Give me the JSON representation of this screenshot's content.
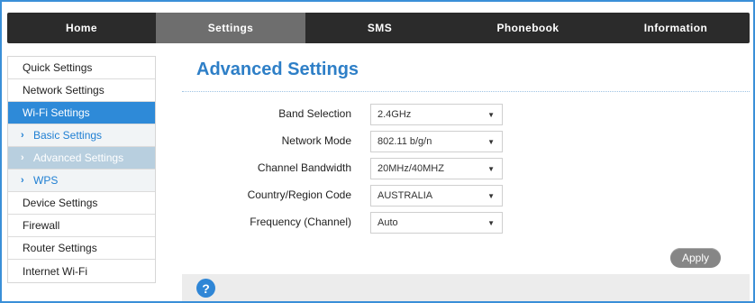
{
  "topnav": {
    "tabs": [
      {
        "label": "Home",
        "active": false
      },
      {
        "label": "Settings",
        "active": true
      },
      {
        "label": "SMS",
        "active": false
      },
      {
        "label": "Phonebook",
        "active": false
      },
      {
        "label": "Information",
        "active": false
      }
    ]
  },
  "sidebar": {
    "items": [
      {
        "label": "Quick Settings",
        "type": "item"
      },
      {
        "label": "Network Settings",
        "type": "item"
      },
      {
        "label": "Wi-Fi Settings",
        "type": "item",
        "active": true
      },
      {
        "label": "Basic Settings",
        "type": "sub"
      },
      {
        "label": "Advanced Settings",
        "type": "sub",
        "selected": true
      },
      {
        "label": "WPS",
        "type": "sub"
      },
      {
        "label": "Device Settings",
        "type": "item"
      },
      {
        "label": "Firewall",
        "type": "item"
      },
      {
        "label": "Router Settings",
        "type": "item"
      },
      {
        "label": "Internet Wi-Fi",
        "type": "item"
      }
    ],
    "chevron": "›"
  },
  "main": {
    "title": "Advanced Settings",
    "fields": [
      {
        "label": "Band Selection",
        "value": "2.4GHz"
      },
      {
        "label": "Network Mode",
        "value": "802.11 b/g/n"
      },
      {
        "label": "Channel Bandwidth",
        "value": "20MHz/40MHZ"
      },
      {
        "label": "Country/Region Code",
        "value": "AUSTRALIA"
      },
      {
        "label": "Frequency (Channel)",
        "value": "Auto"
      }
    ],
    "apply_label": "Apply"
  },
  "footer": {
    "help_glyph": "?"
  },
  "colors": {
    "accent": "#2e8ad8",
    "title": "#2e7fc7",
    "nav_bg": "#2b2b2b",
    "nav_active": "#6e6e6e",
    "apply_bg": "#868686"
  },
  "icons": {
    "dropdown": "dropdown-arrow-icon",
    "help": "help-icon",
    "chevron": "chevron-right-icon"
  }
}
